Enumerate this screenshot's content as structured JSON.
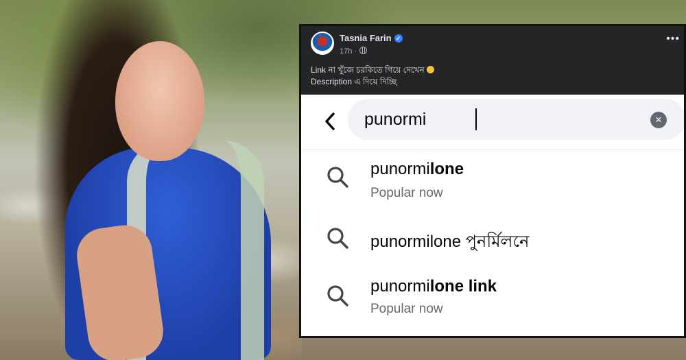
{
  "post": {
    "author": "Tasnia Farin",
    "time": "17h",
    "line1": "Link না খুঁজে চরকিতে গিয়ে দেখেন",
    "line2": "Description এ দিয়ে দিচ্ছি"
  },
  "search": {
    "query": "punormi",
    "suggestions": [
      {
        "typed": "punormi",
        "completion": "lone",
        "subtitle": "Popular now"
      },
      {
        "full": "punormilone পুনর্মিলনে"
      },
      {
        "typed": "punormi",
        "completion": "lone link",
        "subtitle": "Popular now"
      }
    ]
  },
  "colors": {
    "post_header_bg": "#242526",
    "verified_badge": "#2d88ff",
    "search_box_bg": "#f0f2f5",
    "subtitle_gray": "#65676b",
    "top_blue": "#2f5fd6"
  },
  "icons": [
    "back-chevron-icon",
    "clear-icon",
    "search-icon",
    "globe-icon",
    "more-icon",
    "verified-badge-icon",
    "worried-face-emoji"
  ]
}
